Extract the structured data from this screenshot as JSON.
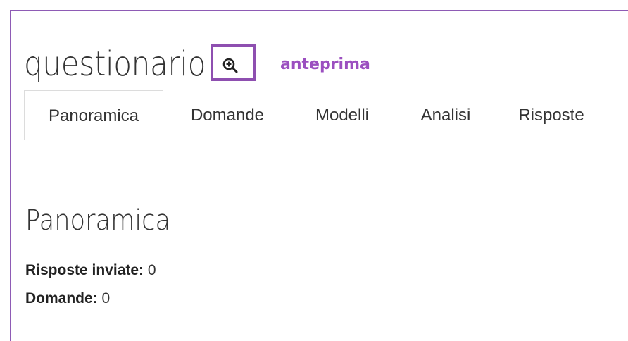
{
  "header": {
    "title": "questionario",
    "zoom_icon": "zoom-in-icon",
    "preview_label": "anteprima"
  },
  "tabs": [
    {
      "label": "Panoramica",
      "active": true
    },
    {
      "label": "Domande",
      "active": false
    },
    {
      "label": "Modelli",
      "active": false
    },
    {
      "label": "Analisi",
      "active": false
    },
    {
      "label": "Risposte",
      "active": false
    }
  ],
  "overview": {
    "title": "Panoramica",
    "stats": [
      {
        "label": "Risposte inviate:",
        "value": "0"
      },
      {
        "label": "Domande:",
        "value": "0"
      }
    ]
  },
  "colors": {
    "frame": "#8e5bb5",
    "highlight_box": "#8e4fb0",
    "preview_text": "#9b4fc0",
    "text": "#333333"
  }
}
